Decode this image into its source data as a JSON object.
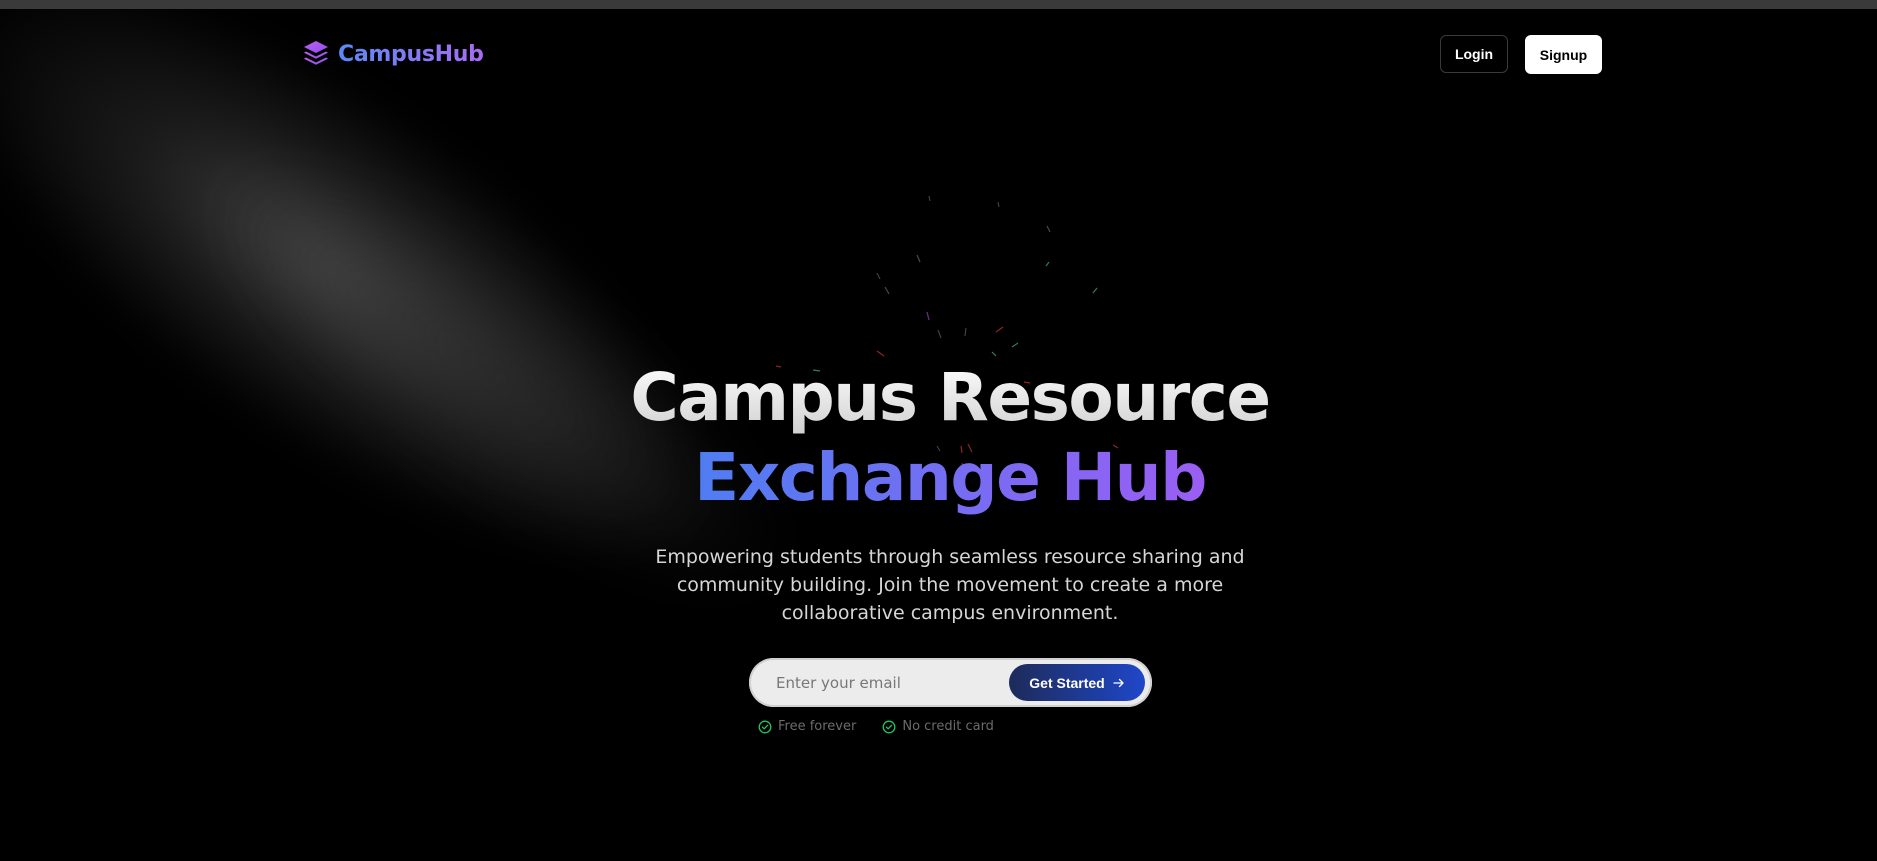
{
  "brand": {
    "name": "CampusHub",
    "logo_icon": "stacked-layers-icon",
    "gradient_from": "#5b8af5",
    "gradient_to": "#a96cf5"
  },
  "nav": {
    "login_label": "Login",
    "signup_label": "Signup"
  },
  "hero": {
    "title_line1": "Campus Resource",
    "title_line2": "Exchange Hub",
    "subtitle": "Empowering students through seamless resource sharing and community building. Join the movement to create a more collaborative campus environment."
  },
  "signup_form": {
    "email_placeholder": "Enter your email",
    "email_value": "",
    "submit_label": "Get Started",
    "submit_icon": "arrow-right-icon"
  },
  "perks": [
    {
      "label": "Free forever",
      "icon": "check-circle-icon"
    },
    {
      "label": "No credit card",
      "icon": "check-circle-icon"
    }
  ],
  "colors": {
    "background": "#000000",
    "accent_blue": "#1f47c9",
    "check_green": "#22c55e"
  }
}
